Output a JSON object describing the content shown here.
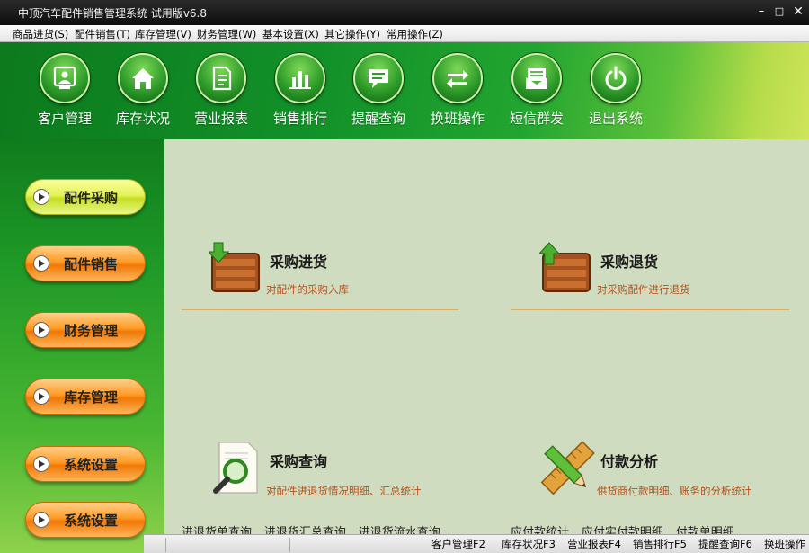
{
  "window": {
    "title": "中顶汽车配件销售管理系统 试用版v6.8",
    "controls": {
      "minimize": "–",
      "maximize": "□",
      "close": "✕"
    }
  },
  "menu": [
    "商品进货(S)",
    "配件销售(T)",
    "库存管理(V)",
    "财务管理(W)",
    "基本设置(X)",
    "其它操作(Y)",
    "常用操作(Z)"
  ],
  "toolbar": [
    {
      "label": "客户管理",
      "icon": "customer-icon"
    },
    {
      "label": "库存状况",
      "icon": "home-icon"
    },
    {
      "label": "营业报表",
      "icon": "report-icon"
    },
    {
      "label": "销售排行",
      "icon": "bar-chart-icon"
    },
    {
      "label": "提醒查询",
      "icon": "message-icon"
    },
    {
      "label": "换班操作",
      "icon": "swap-icon"
    },
    {
      "label": "短信群发",
      "icon": "sms-icon"
    },
    {
      "label": "退出系统",
      "icon": "power-icon"
    }
  ],
  "sidebar": [
    {
      "label": "配件采购",
      "style": "yellow"
    },
    {
      "label": "配件销售",
      "style": "orange"
    },
    {
      "label": "财务管理",
      "style": "orange"
    },
    {
      "label": "库存管理",
      "style": "orange"
    },
    {
      "label": "系统设置",
      "style": "orange"
    },
    {
      "label": "系统设置",
      "style": "orange"
    }
  ],
  "features": [
    {
      "title": "采购进货",
      "desc": "对配件的采购入库",
      "icon": "box-in-icon"
    },
    {
      "title": "采购退货",
      "desc": "对采购配件进行退货",
      "icon": "box-return-icon"
    },
    {
      "title": "采购查询",
      "desc": "对配件进退货情况明细、汇总统计",
      "icon": "search-doc-icon"
    },
    {
      "title": "付款分析",
      "desc": "供货商付款明细、账务的分析统计",
      "icon": "pencil-ruler-icon"
    }
  ],
  "sublinks_left": [
    "进退货单查询",
    "进退货汇总查询",
    "进退货流水查询"
  ],
  "sublinks_right": [
    "应付款统计",
    "应付实付款明细",
    "付款单明细"
  ],
  "statusbar": [
    "客户管理F2",
    "库存状况F3",
    "营业报表F4",
    "销售排行F5",
    "提醒查询F6",
    "换班操作"
  ]
}
